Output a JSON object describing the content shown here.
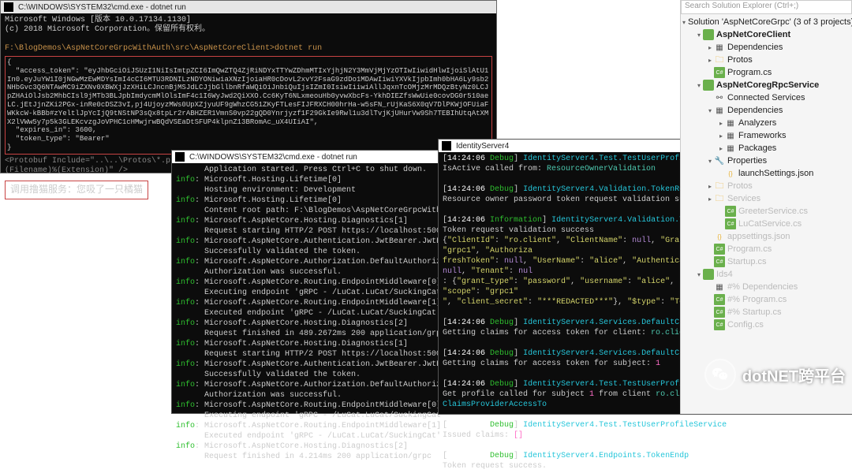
{
  "cmd_top": {
    "title": "C:\\WINDOWS\\SYSTEM32\\cmd.exe - dotnet  run",
    "os_line": "Microsoft Windows [版本 10.0.17134.1130]",
    "copyright": "(c) 2018 Microsoft Corporation。保留所有权利。",
    "path_prompt": "F:\\BlogDemos\\AspNetCoreGrpcWithAuth\\src\\AspNetCoreClient>dotnet run",
    "token_json": "{\n  \"access_token\": \"eyJhbGciOiJSUzI1NiIsImtpZCI6ImQwZTQ4ZjRiNDYxTTYwZDhmMTIxYjhjN2Y3MmVjMjYzOTIwIiwidHlwIjoiSlAtU1In0.eyJuYW1I0jNGwMzEwMDYsImI4cCI6MTU3RDNILzNDYONiwiaXNzIjoiaHR0cDovL2xvY2FsaG9zdDo1MDAwIiwiYXVkIjpbImh0bHA6Ly9sb2NHbGvc3Q6NTAwMC9iZXNv0XBWXjJzXHiLCJncnBjMSJdLCJjbGllbnRfaWQiOiJnbiQuIjsIZmI0IsiwIiiwiAllJqxnTcOMjzMrMDQzBtyNz0LCJpZHAiOlJsb2MhbCIsl9jMTb3BLJpbImdycmMlOlsImF4c1I6WyJwd2QiXXO.Cc6KyT6NLxmeouHb0yvwXbcFs-YkhDIEZfsWwUie0covDG0r510aeLC.jEtJjnZKi2PGx-inRe0cDSZ3vI,pj4UjoyzMWs0UpXZjyuUF9gWhzCG51ZKyFTLesFIJFRXCH00hrHa-w5sFN_rUjKaS6X0qV7DlPKWjOFUiaFWKkcW-kBBb#zYeltlJpYcIjQ9tNStNP3sQx8tpLr2rABHZER1VmnS0vp22gQD0Ynrjyzf1F29GkIe9Rwl1u3dlTvjKjUHurVw9Sh7TEBIhUtqAtXMX2lVWw5y7p5k3GLEKcvzgJoVPHC1cHMwjrwBQdVSEaDtSFUP4klpnZ13BRomAc_uX4UIiAI\",\n  \"expires_in\": 3600,\n  \"token_type\": \"Bearer\"\n}",
    "comment_text": "<Protobuf Include=\"..\\..\\Protos\\*.proto\" GrpcServices=\"Client\" Link=\"Protos\\%(RecursiveDir)%(Filename)%(Extension)\" />",
    "result": "调用撸猫服务：您吸了一只橘猫"
  },
  "cmd_mid": {
    "title": "C:\\WINDOWS\\SYSTEM32\\cmd.exe - dotnet  run",
    "lines": [
      {
        "p": "",
        "t": "Application started. Press Ctrl+C to shut down."
      },
      {
        "p": "info",
        "t": ": Microsoft.Hosting.Lifetime[0]"
      },
      {
        "p": "",
        "t": "Hosting environment: Development"
      },
      {
        "p": "info",
        "t": ": Microsoft.Hosting.Lifetime[0]"
      },
      {
        "p": "",
        "t": "Content root path: F:\\BlogDemos\\AspNetCoreGrpcWithAuth\\src\\"
      },
      {
        "p": "info",
        "t": ": Microsoft.AspNetCore.Hosting.Diagnostics[1]"
      },
      {
        "p": "",
        "t": "Request starting HTTP/2 POST https://localhost:5001/LuCat."
      },
      {
        "p": "info",
        "t": ": Microsoft.AspNetCore.Authentication.JwtBearer.JwtBearerHan"
      },
      {
        "p": "",
        "t": "Successfully validated the token."
      },
      {
        "p": "info",
        "t": ": Microsoft.AspNetCore.Authorization.DefaultAuthorizationSer"
      },
      {
        "p": "",
        "t": "Authorization was successful."
      },
      {
        "p": "info",
        "t": ": Microsoft.AspNetCore.Routing.EndpointMiddleware[0]"
      },
      {
        "p": "",
        "t": "Executing endpoint 'gRPC - /LuCat.LuCat/SuckingCat'"
      },
      {
        "p": "info",
        "t": ": Microsoft.AspNetCore.Routing.EndpointMiddleware[1]"
      },
      {
        "p": "",
        "t": "Executed endpoint 'gRPC - /LuCat.LuCat/SuckingCat'"
      },
      {
        "p": "info",
        "t": ": Microsoft.AspNetCore.Hosting.Diagnostics[2]"
      },
      {
        "p": "",
        "t": "Request finished in 489.2672ms 200 application/grpc"
      },
      {
        "p": "info",
        "t": ": Microsoft.AspNetCore.Hosting.Diagnostics[1]"
      },
      {
        "p": "",
        "t": "Request starting HTTP/2 POST https://localhost:5001/LuCat."
      },
      {
        "p": "info",
        "t": ": Microsoft.AspNetCore.Authentication.JwtBearer.JwtBearerHan"
      },
      {
        "p": "",
        "t": "Successfully validated the token."
      },
      {
        "p": "info",
        "t": ": Microsoft.AspNetCore.Authorization.DefaultAuthorizationSer"
      },
      {
        "p": "",
        "t": "Authorization was successful."
      },
      {
        "p": "info",
        "t": ": Microsoft.AspNetCore.Routing.EndpointMiddleware[0]"
      },
      {
        "p": "",
        "t": "Executing endpoint 'gRPC - /LuCat.LuCat/SuckingCat'"
      },
      {
        "p": "info",
        "t": ": Microsoft.AspNetCore.Routing.EndpointMiddleware[1]"
      },
      {
        "p": "",
        "t": "Executed endpoint 'gRPC - /LuCat.LuCat/SuckingCat'"
      },
      {
        "p": "info",
        "t": ": Microsoft.AspNetCore.Hosting.Diagnostics[2]"
      },
      {
        "p": "",
        "t": "Request finished in 4.214ms 200 application/grpc"
      }
    ]
  },
  "cmd_ids": {
    "title": "IdentityServer4",
    "body_html": "[<span class='white'>14:24:06</span> <span class='dbg-green'>Debug</span>] <span class='cyan'>IdentityServer4.Test.TestUserProfileService</span><br>IsActive called from: <span class='teal'>ResourceOwnerValidation</span><br><br>[<span class='white'>14:24:06</span> <span class='dbg-green'>Debug</span>] <span class='cyan'>IdentityServer4.Validation.TokenRequestValidator</span><br>Resource owner password token request validation success.<br><br>[<span class='white'>14:24:06</span> <span class='dbg-green'>Information</span>] <span class='cyan'>IdentityServer4.Validation.TokenRequestValidator</span><br>Token request validation success<br>{<span class='yellow'>\"ClientId\"</span>: <span class='yellow'>\"ro.client\"</span>, <span class='yellow'>\"ClientName\"</span>: <span class='purple'>null</span>, <span class='yellow'>\"GrantType\"</span>: <span class='yellow'>\"password\"</span>, <span class='yellow'>\"Scopes\"</span>: <span class='yellow'>\"grpc1\"</span>, <span class='yellow'>\"Authoriza</span><br><span class='yellow'>freshToken\"</span>: <span class='purple'>null</span>, <span class='yellow'>\"UserName\"</span>: <span class='yellow'>\"alice\"</span>, <span class='yellow'>\"AuthenticationContextReferenceClasses\"</span>: <span class='purple'>null</span>, <span class='yellow'>\"Tenant\"</span>: <span class='purple'>nul</span><br>: {<span class='yellow'>\"grant_type\"</span>: <span class='yellow'>\"password\"</span>, <span class='yellow'>\"username\"</span>: <span class='yellow'>\"alice\"</span>, <span class='yellow'>\"password\"</span>: <span class='yellow'>\"***REDACTED***\"</span>, <span class='yellow'>\"scope\"</span>: <span class='yellow'>\"grpc1\"</span><br><span class='yellow'>\"</span>, <span class='yellow'>\"client_secret\"</span>: <span class='yellow'>\"***REDACTED***\"</span>}, <span class='yellow'>\"$type\"</span>: <span class='yellow'>\"TokenRequestValidationLog\"</span>}<br><br>[<span class='white'>14:24:06</span> <span class='dbg-green'>Debug</span>] <span class='cyan'>IdentityServer4.Services.DefaultClaimsService</span><br>Getting claims for access token for client: <span class='teal'>ro.client</span><br><br>[<span class='white'>14:24:06</span> <span class='dbg-green'>Debug</span>] <span class='cyan'>IdentityServer4.Services.DefaultClaimsService</span><br>Getting claims for access token for subject: <span class='hot'>1</span><br><br>[<span class='white'>14:24:06</span> <span class='dbg-green'>Debug</span>] <span class='cyan'>IdentityServer4.Test.TestUserProfileService</span><br>Get profile called for subject <span class='hot'>1</span> from client <span class='teal'>ro.client</span> with claim types <span class='hot'>[]</span> via <span class='cyan'>ClaimsProviderAccessTo</span><br><br>[<span class='white'>14:24:06</span> <span class='dbg-green'>Debug</span>] <span class='cyan'>IdentityServer4.Test.TestUserProfileService</span><br>Issued claims: <span class='hot'>[]</span><br><br>[<span class='white'>14:24:06</span> <span class='dbg-green'>Debug</span>] <span class='cyan'>IdentityServer4.Endpoints.TokenEndp</span><br>Token request success."
  },
  "solution": {
    "search": "Search Solution Explorer (Ctrl+;)",
    "sol_label": "Solution 'AspNetCoreGrpc' (3 of 3 projects)",
    "tree": [
      {
        "d": 1,
        "exp": "▾",
        "ico": "csproj",
        "lbl": "AspNetCoreClient",
        "bold": true
      },
      {
        "d": 2,
        "exp": "▸",
        "ico": "dep",
        "lbl": "Dependencies"
      },
      {
        "d": 2,
        "exp": "▸",
        "ico": "folder",
        "lbl": "Protos"
      },
      {
        "d": 2,
        "exp": "",
        "ico": "cs",
        "lbl": "Program.cs"
      },
      {
        "d": 1,
        "exp": "▾",
        "ico": "csproj",
        "lbl": "AspNetCoregRpcService",
        "bold": true
      },
      {
        "d": 2,
        "exp": "",
        "ico": "conn",
        "lbl": "Connected Services"
      },
      {
        "d": 2,
        "exp": "▾",
        "ico": "dep",
        "lbl": "Dependencies"
      },
      {
        "d": 3,
        "exp": "▸",
        "ico": "dep",
        "lbl": "Analyzers"
      },
      {
        "d": 3,
        "exp": "▸",
        "ico": "dep",
        "lbl": "Frameworks"
      },
      {
        "d": 3,
        "exp": "▸",
        "ico": "dep",
        "lbl": "Packages"
      },
      {
        "d": 2,
        "exp": "▾",
        "ico": "wrench",
        "lbl": "Properties"
      },
      {
        "d": 3,
        "exp": "",
        "ico": "json",
        "lbl": "launchSettings.json"
      },
      {
        "d": 2,
        "exp": "▸",
        "ico": "folder",
        "lbl": "Protos",
        "dim": true
      },
      {
        "d": 2,
        "exp": "▸",
        "ico": "folder",
        "lbl": "Services",
        "dim": true
      },
      {
        "d": 3,
        "exp": "",
        "ico": "cs",
        "lbl": "GreeterService.cs",
        "dim": true
      },
      {
        "d": 3,
        "exp": "",
        "ico": "cs",
        "lbl": "LuCatService.cs",
        "dim": true
      },
      {
        "d": 2,
        "exp": "",
        "ico": "json",
        "lbl": "appsettings.json",
        "dim": true
      },
      {
        "d": 2,
        "exp": "",
        "ico": "cs",
        "lbl": "Program.cs",
        "dim": true
      },
      {
        "d": 2,
        "exp": "",
        "ico": "cs",
        "lbl": "Startup.cs",
        "dim": true
      },
      {
        "d": 1,
        "exp": "▾",
        "ico": "csproj",
        "lbl": "Ids4",
        "dim": true
      },
      {
        "d": 2,
        "exp": "",
        "ico": "dep",
        "lbl": "#% Dependencies",
        "dim": true
      },
      {
        "d": 2,
        "exp": "",
        "ico": "cs",
        "lbl": "#% Program.cs",
        "dim": true
      },
      {
        "d": 2,
        "exp": "",
        "ico": "cs",
        "lbl": "#% Startup.cs",
        "dim": true
      },
      {
        "d": 2,
        "exp": "",
        "ico": "cs",
        "lbl": "Config.cs",
        "dim": true
      }
    ]
  },
  "watermark": "dotNET跨平台"
}
